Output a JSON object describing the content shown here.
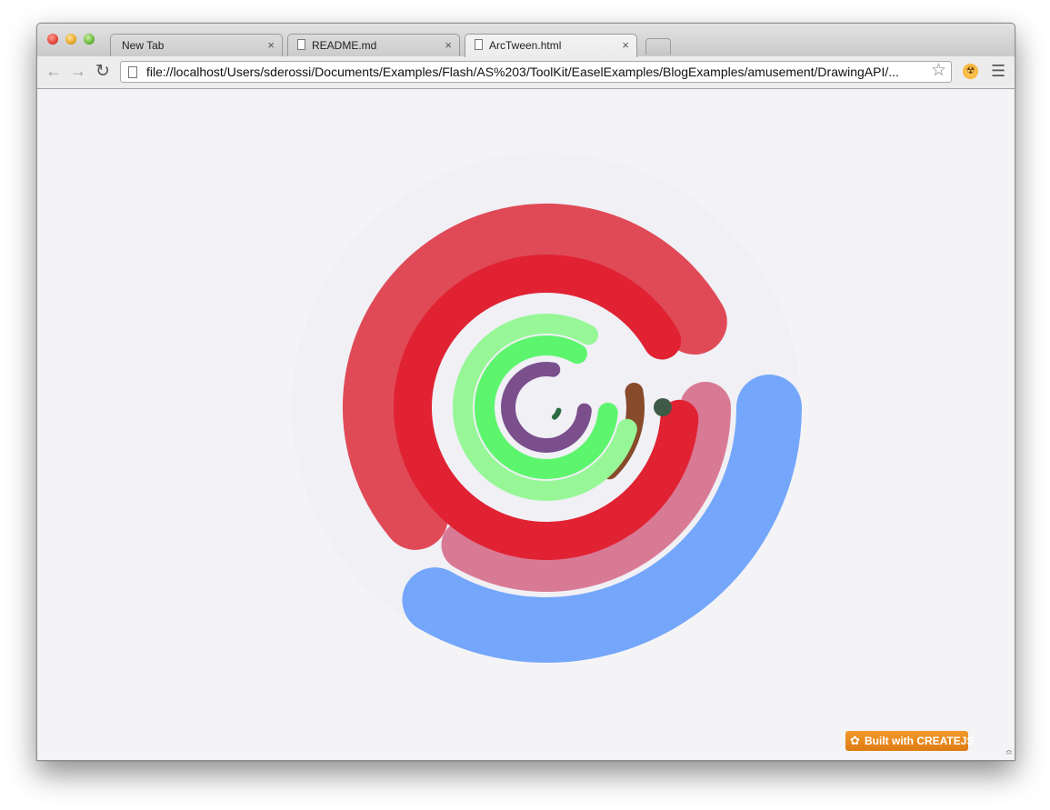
{
  "browser": {
    "tabs": [
      {
        "label": "New Tab",
        "has_icon": false
      },
      {
        "label": "README.md",
        "has_icon": true
      },
      {
        "label": "ArcTween.html",
        "has_icon": true,
        "active": true
      }
    ],
    "tab_close_glyph": "×",
    "url": "file://localhost/Users/sderossi/Documents/Examples/Flash/AS%203/ToolKit/EaselExamples/BlogExamples/amusement/DrawingAPI/...",
    "icons": {
      "back": "back-arrow-icon",
      "forward": "forward-arrow-icon",
      "reload": "reload-icon",
      "page": "document-icon",
      "bookmark": "star-icon",
      "extension": "radiation-icon",
      "menu": "hamburger-menu-icon"
    }
  },
  "page": {
    "background": "#f4f4f6",
    "badge_label": "Built with CREATEJS",
    "arcs": [
      {
        "name": "faint-background-disc",
        "color": "#f0f0f5"
      },
      {
        "name": "outer-red-arc",
        "color": "#e04a57"
      },
      {
        "name": "pink-arc",
        "color": "#d97a95"
      },
      {
        "name": "crimson-arc",
        "color": "#e02233"
      },
      {
        "name": "dark-green-arc",
        "color": "#3f5a47"
      },
      {
        "name": "brown-arc",
        "color": "#874a2b"
      },
      {
        "name": "light-green-arc",
        "color": "#97f797"
      },
      {
        "name": "green-arc",
        "color": "#5ef56e"
      },
      {
        "name": "purple-arc",
        "color": "#7a4f8c"
      },
      {
        "name": "small-dark-green-arc",
        "color": "#2d6a40"
      },
      {
        "name": "blue-arc",
        "color": "#74a6fb"
      }
    ]
  }
}
